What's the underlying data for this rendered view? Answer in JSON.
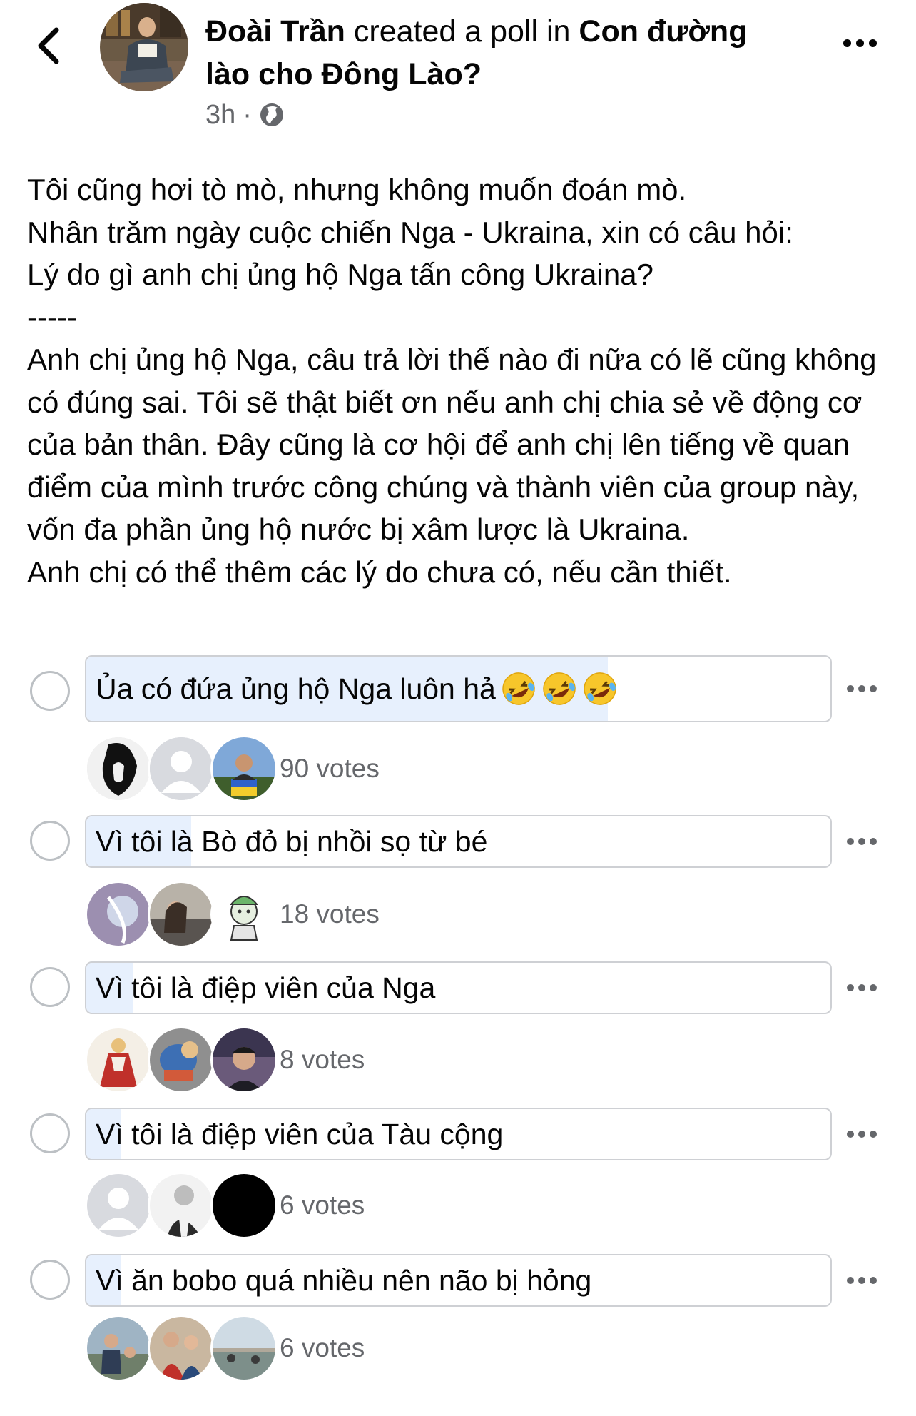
{
  "header": {
    "author": "Đoài Trần",
    "action": " created a poll in ",
    "group": "Con đường lào cho Đông Lào?",
    "time": "3h",
    "separator": "·",
    "icons": {
      "back": "chevron-left-icon",
      "audience": "globe-icon",
      "more": "more-horizontal-icon"
    }
  },
  "post": {
    "lines": [
      "Tôi cũng hơi tò mò, nhưng không muốn đoán mò.",
      "Nhân trăm ngày cuộc chiến Nga - Ukraina, xin có câu hỏi:",
      "Lý do gì anh chị ủng hộ Nga tấn công Ukraina?",
      "-----",
      "Anh chị ủng hộ Nga, câu trả lời thế nào đi nữa có lẽ cũng không có đúng sai. Tôi sẽ thật biết ơn nếu anh chị chia sẻ về động cơ của bản thân. Đây cũng là cơ hội để anh chị lên tiếng về quan điểm của mình trước công chúng và thành viên của group này, vốn đa phần ủng hộ nước bị xâm lược là Ukraina.",
      "Anh chị có thể thêm các lý do chưa có, nếu cần thiết."
    ]
  },
  "poll": {
    "accent_fill": "#e7f0fd",
    "options": [
      {
        "label": "Ủa có đứa ủng hộ Nga luôn hả",
        "emoji": "rolling-on-floor-laughing",
        "emoji_count": 3,
        "votes": "90 votes",
        "share": 0.701
      },
      {
        "label": "Vì tôi là Bò đỏ bị nhồi sọ từ bé",
        "votes": "18 votes",
        "share": 0.141
      },
      {
        "label": "Vì tôi là điệp viên của Nga",
        "votes": "8 votes",
        "share": 0.063
      },
      {
        "label": "Vì tôi là điệp viên của Tàu cộng",
        "votes": "6 votes",
        "share": 0.047
      },
      {
        "label": "Vì ăn bobo quá nhiều nên não bị hỏng",
        "votes": "6 votes",
        "share": 0.047
      }
    ]
  }
}
